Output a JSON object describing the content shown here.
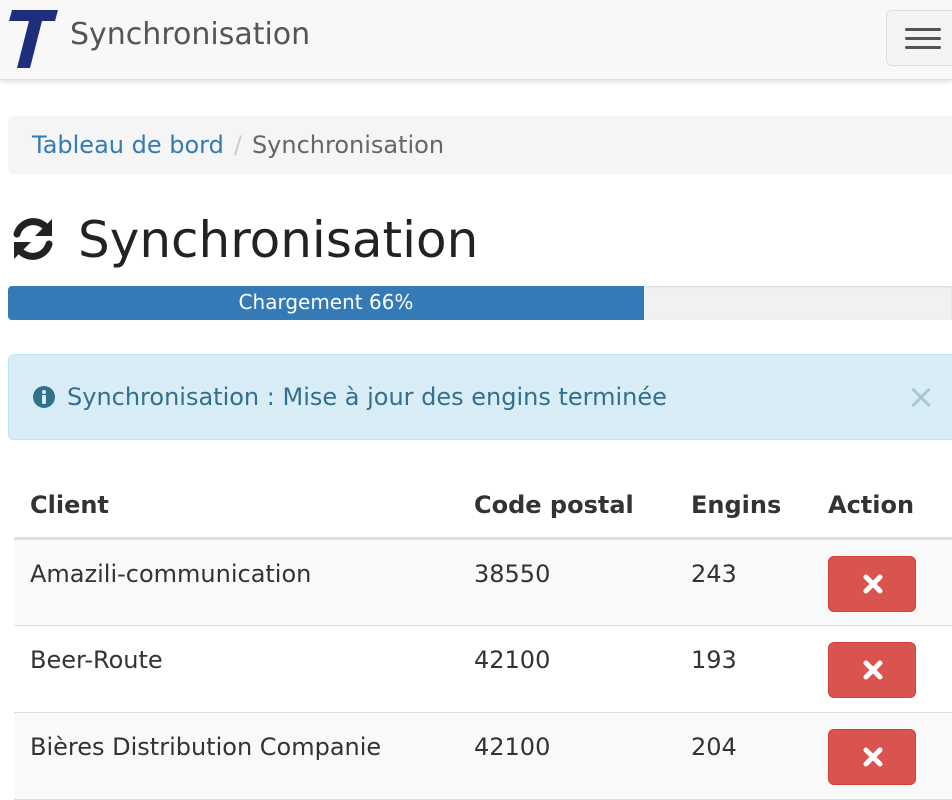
{
  "navbar": {
    "title": "Synchronisation",
    "logo_letter": "T",
    "menu_icon": "hamburger-icon"
  },
  "breadcrumb": {
    "home": "Tableau de bord",
    "separator": "/",
    "current": "Synchronisation"
  },
  "heading": {
    "icon": "refresh-icon",
    "title": "Synchronisation"
  },
  "progress": {
    "label": "Chargement 66%",
    "percent": 66
  },
  "alert": {
    "icon": "info-circle-icon",
    "message": "Synchronisation : Mise à jour des engins terminée",
    "close": "×"
  },
  "table": {
    "headers": {
      "client": "Client",
      "code_postal": "Code postal",
      "engins": "Engins",
      "action": "Action"
    },
    "rows": [
      {
        "client": "Amazili-communication",
        "code_postal": "38550",
        "engins": "243"
      },
      {
        "client": "Beer-Route",
        "code_postal": "42100",
        "engins": "193"
      },
      {
        "client": "Bières Distribution Companie",
        "code_postal": "42100",
        "engins": "204"
      }
    ],
    "action_icon": "times-icon"
  },
  "colors": {
    "primary": "#337ab7",
    "danger": "#d9534f",
    "info_bg": "#d9edf7",
    "info_text": "#31708f",
    "logo": "#1f2e7a"
  }
}
